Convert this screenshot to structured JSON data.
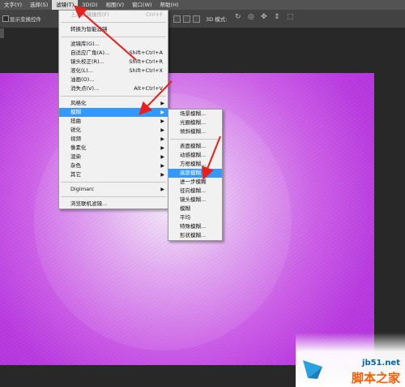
{
  "menubar": {
    "items": [
      "文字(Y)",
      "选择(S)",
      "滤镜(T)",
      "3D(D)",
      "视图(V)",
      "窗口(W)",
      "帮助(H)"
    ],
    "active_index": 2
  },
  "options_bar": {
    "show_transform_label": "显示变换控件",
    "mode_3d_label": "3D 模式:"
  },
  "filter_menu": {
    "items": [
      {
        "label": "上次滤镜操作(F)",
        "shortcut": "Ctrl+F",
        "disabled": true
      },
      {
        "sep": true
      },
      {
        "label": "转换为智能滤镜"
      },
      {
        "sep": true
      },
      {
        "label": "滤镜库(G)..."
      },
      {
        "label": "自适应广角(A)...",
        "shortcut": "Shift+Ctrl+A"
      },
      {
        "label": "镜头校正(R)...",
        "shortcut": "Shift+Ctrl+R"
      },
      {
        "label": "液化(L)...",
        "shortcut": "Shift+Ctrl+X"
      },
      {
        "label": "油画(O)..."
      },
      {
        "label": "消失点(V)...",
        "shortcut": "Alt+Ctrl+V"
      },
      {
        "sep": true
      },
      {
        "label": "风格化",
        "submenu": true
      },
      {
        "label": "模糊",
        "submenu": true,
        "highlighted": true
      },
      {
        "label": "扭曲",
        "submenu": true
      },
      {
        "label": "锐化",
        "submenu": true
      },
      {
        "label": "视频",
        "submenu": true
      },
      {
        "label": "像素化",
        "submenu": true
      },
      {
        "label": "渲染",
        "submenu": true
      },
      {
        "label": "杂色",
        "submenu": true
      },
      {
        "label": "其它",
        "submenu": true
      },
      {
        "sep": true
      },
      {
        "label": "Digimarc",
        "submenu": true
      },
      {
        "sep": true
      },
      {
        "label": "浏览联机滤镜..."
      }
    ]
  },
  "blur_menu": {
    "items": [
      {
        "label": "场景模糊..."
      },
      {
        "label": "光圈模糊..."
      },
      {
        "label": "倾斜模糊..."
      },
      {
        "sep": true
      },
      {
        "label": "表面模糊..."
      },
      {
        "label": "动感模糊..."
      },
      {
        "label": "方框模糊..."
      },
      {
        "label": "高斯模糊...",
        "highlighted": true
      },
      {
        "label": "进一步模糊"
      },
      {
        "label": "径向模糊..."
      },
      {
        "label": "镜头模糊..."
      },
      {
        "label": "模糊"
      },
      {
        "label": "平均"
      },
      {
        "label": "特殊模糊..."
      },
      {
        "label": "形状模糊..."
      }
    ]
  },
  "colors": {
    "highlight": "#3399ff",
    "arrow": "#e8201c",
    "canvas_center": "#f5eafb",
    "canvas_edge": "#b030dc"
  },
  "watermark": {
    "domain": "jb51.net",
    "name": "脚本之家"
  }
}
